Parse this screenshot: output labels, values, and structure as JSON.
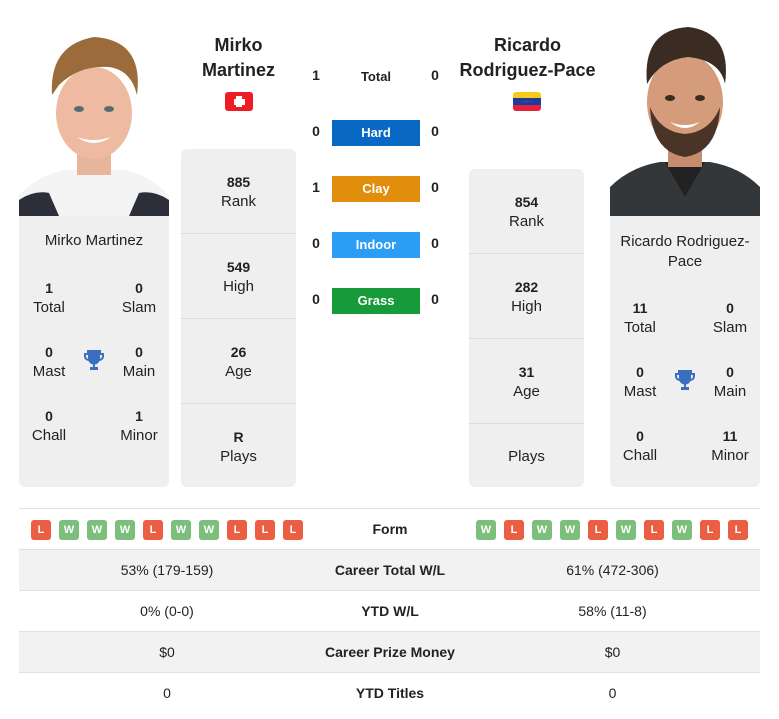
{
  "h2h": {
    "total": {
      "label": "Total",
      "left": "1",
      "right": "0"
    },
    "surfaces": [
      {
        "label": "Hard",
        "left": "0",
        "right": "0",
        "color": "#0868c4"
      },
      {
        "label": "Clay",
        "left": "1",
        "right": "0",
        "color": "#e08e0b"
      },
      {
        "label": "Indoor",
        "left": "0",
        "right": "0",
        "color": "#2b9df4"
      },
      {
        "label": "Grass",
        "left": "0",
        "right": "0",
        "color": "#169a3a"
      }
    ]
  },
  "player1": {
    "name_line1": "Mirko",
    "name_line2": "Martinez",
    "full_name": "Mirko Martinez",
    "flag": "switzerland-flag",
    "stats": [
      {
        "value": "885",
        "label": "Rank"
      },
      {
        "value": "549",
        "label": "High"
      },
      {
        "value": "26",
        "label": "Age"
      },
      {
        "value": "R",
        "label": "Plays"
      }
    ],
    "titles": {
      "total": {
        "value": "1",
        "label": "Total"
      },
      "slam": {
        "value": "0",
        "label": "Slam"
      },
      "mast": {
        "value": "0",
        "label": "Mast"
      },
      "main": {
        "value": "0",
        "label": "Main"
      },
      "chall": {
        "value": "0",
        "label": "Chall"
      },
      "minor": {
        "value": "1",
        "label": "Minor"
      }
    },
    "form": [
      "L",
      "W",
      "W",
      "W",
      "L",
      "W",
      "W",
      "L",
      "L",
      "L"
    ]
  },
  "player2": {
    "name_line1": "Ricardo",
    "name_line2": "Rodriguez-Pace",
    "full_name_line1": "Ricardo Rodriguez-",
    "full_name_line2": "Pace",
    "flag": "venezuela-flag",
    "stats": [
      {
        "value": "854",
        "label": "Rank"
      },
      {
        "value": "282",
        "label": "High"
      },
      {
        "value": "31",
        "label": "Age"
      },
      {
        "value": "",
        "label": "Plays"
      }
    ],
    "titles": {
      "total": {
        "value": "11",
        "label": "Total"
      },
      "slam": {
        "value": "0",
        "label": "Slam"
      },
      "mast": {
        "value": "0",
        "label": "Mast"
      },
      "main": {
        "value": "0",
        "label": "Main"
      },
      "chall": {
        "value": "0",
        "label": "Chall"
      },
      "minor": {
        "value": "11",
        "label": "Minor"
      }
    },
    "form": [
      "W",
      "L",
      "W",
      "W",
      "L",
      "W",
      "L",
      "W",
      "L",
      "L"
    ]
  },
  "colors": {
    "win": "#7cbf7c",
    "loss": "#ea5e44",
    "trophy": "#3a6fbf"
  },
  "comparison": [
    {
      "label": "Form",
      "left": "",
      "right": ""
    },
    {
      "label": "Career Total W/L",
      "left": "53% (179-159)",
      "right": "61% (472-306)"
    },
    {
      "label": "YTD W/L",
      "left": "0% (0-0)",
      "right": "58% (11-8)"
    },
    {
      "label": "Career Prize Money",
      "left": "$0",
      "right": "$0"
    },
    {
      "label": "YTD Titles",
      "left": "0",
      "right": "0"
    }
  ]
}
